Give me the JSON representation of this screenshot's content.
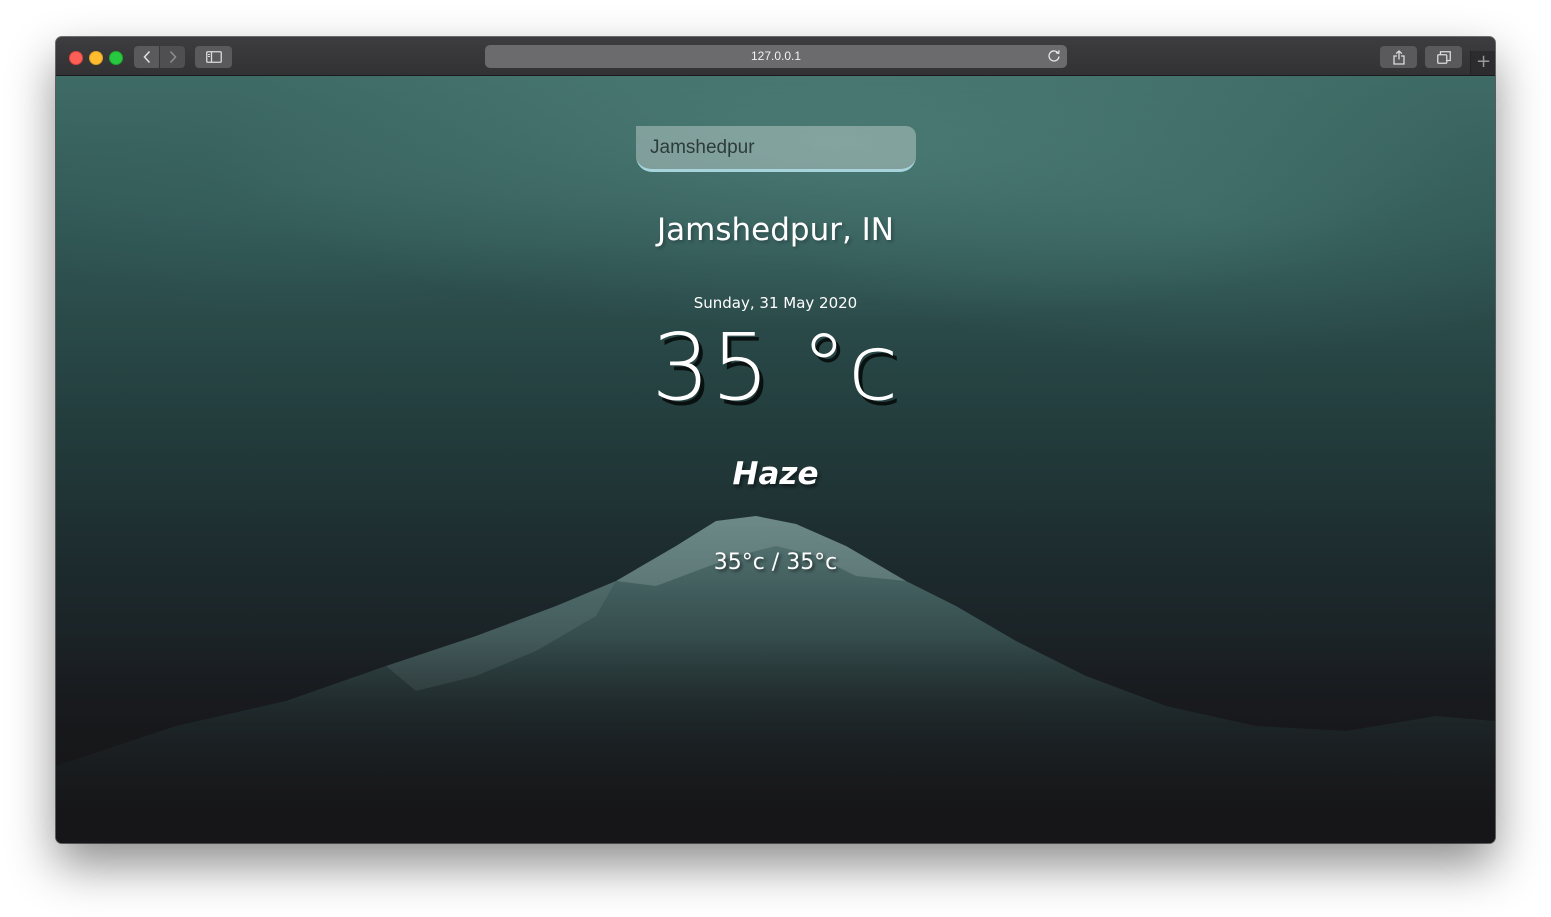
{
  "browser": {
    "address": "127.0.0.1",
    "new_tab_label": "+"
  },
  "icons": {
    "back": "chevron-left-icon",
    "forward": "chevron-right-icon",
    "sidebar": "sidebar-icon",
    "reload": "reload-icon",
    "share": "share-icon",
    "tabs": "tabs-overview-icon"
  },
  "app": {
    "search": {
      "value": "Jamshedpur"
    },
    "location": "Jamshedpur, IN",
    "date": "Sunday, 31 May 2020",
    "temperature": "35 °c",
    "condition": "Haze",
    "hi_low": "35°c / 35°c"
  },
  "colors": {
    "search_underline": "#a7d3dd",
    "sky_top": "#3f6b66",
    "ground": "#161517"
  }
}
